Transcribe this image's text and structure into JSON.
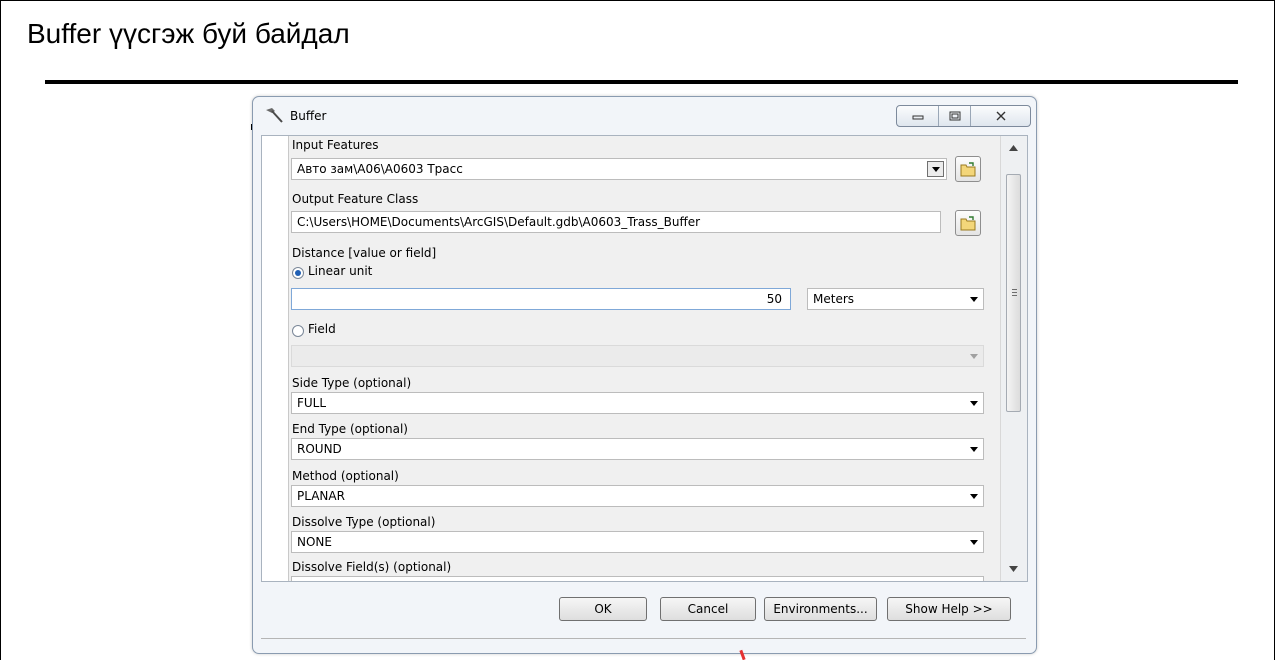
{
  "slide": {
    "title": "Buffer үүсгэж буй байдал"
  },
  "dialog": {
    "title": "Buffer",
    "window_buttons": {
      "minimize_icon": "minimize-icon",
      "restore_icon": "restore-icon",
      "close_icon": "close-icon"
    },
    "params": {
      "input_features": {
        "label": "Input Features",
        "value": "Авто зам\\A06\\A0603 Трасс"
      },
      "output_feature_class": {
        "label": "Output Feature Class",
        "value": "C:\\Users\\HOME\\Documents\\ArcGIS\\Default.gdb\\A0603_Trass_Buffer"
      },
      "distance": {
        "label": "Distance [value or field]",
        "linear_unit_label": "Linear unit",
        "linear_unit_selected": true,
        "value": "50",
        "unit": "Meters",
        "field_label": "Field",
        "field_value": ""
      },
      "side_type": {
        "label": "Side Type (optional)",
        "value": "FULL"
      },
      "end_type": {
        "label": "End Type (optional)",
        "value": "ROUND"
      },
      "method": {
        "label": "Method (optional)",
        "value": "PLANAR"
      },
      "dissolve_type": {
        "label": "Dissolve Type (optional)",
        "value": "NONE"
      },
      "dissolve_fields": {
        "label": "Dissolve Field(s) (optional)"
      }
    },
    "buttons": {
      "ok": "OK",
      "cancel": "Cancel",
      "environments": "Environments...",
      "show_help": "Show Help >>"
    }
  }
}
